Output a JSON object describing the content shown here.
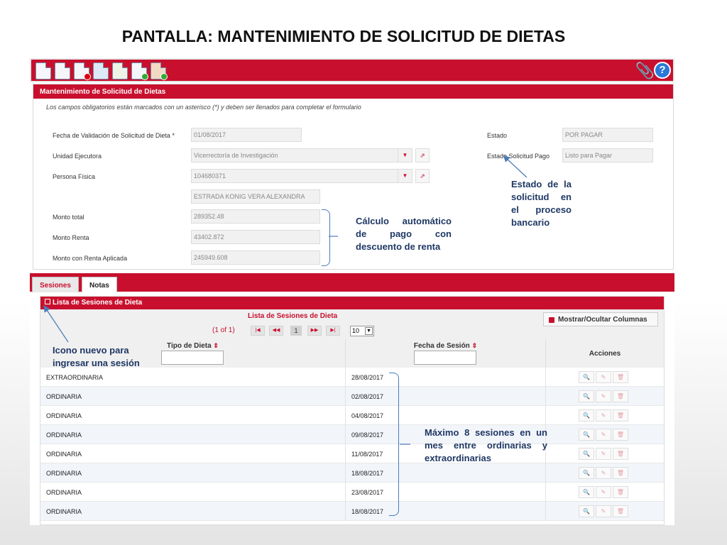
{
  "slide": {
    "title": "PANTALLA: MANTENIMIENTO DE SOLICITUD DE DIETAS"
  },
  "toolbar": {
    "icons": [
      "new-document-icon",
      "document-icon",
      "delete-document-icon",
      "workflow-icon",
      "report-icon",
      "export-document-icon",
      "add-user-icon"
    ],
    "attach_icon": "📎",
    "help_icon": "?"
  },
  "panel": {
    "title": "Mantenimiento de Solicitud de Dietas",
    "required_note": "Los campos obligatorios están marcados con un asterisco (*) y deben ser llenados para completar el formulario",
    "fields": {
      "fecha_label": "Fecha de Validación de Solicitud de Dieta *",
      "fecha_value": "01/08/2017",
      "unidad_label": "Unidad Ejecutora",
      "unidad_value": "Vicerrectoría de Investigación",
      "persona_label": "Persona Física",
      "persona_value": "104680371",
      "nombre_value": "ESTRADA KONIG VERA ALEXANDRA",
      "monto_total_label": "Monto total",
      "monto_total_value": "289352.48",
      "monto_renta_label": "Monto Renta",
      "monto_renta_value": "43402.872",
      "monto_aplicada_label": "Monto con Renta Aplicada",
      "monto_aplicada_value": "245949.608",
      "estado_label": "Estado",
      "estado_value": "POR PAGAR",
      "estado_pago_label": "Estado Solicitud Pago",
      "estado_pago_value": "Listo para Pagar"
    },
    "dropdown_glyph": "▼",
    "external_glyph": "⇗"
  },
  "annotations": {
    "estado": "Estado de la solicitud en el proceso bancario",
    "calculo": "Cálculo automático de pago con descuento de renta",
    "icono": "Icono nuevo para ingresar una sesión",
    "maximo": "Máximo 8 sesiones en un mes entre ordinarias y extraordinarias"
  },
  "tabs": [
    {
      "label": "Sesiones"
    },
    {
      "label": "Notas"
    }
  ],
  "grid": {
    "panel_title": "Lista de Sesiones de Dieta",
    "caption": "Lista de Sesiones de Dieta",
    "pager_count": "(1 of 1)",
    "pager_first": "|◀",
    "pager_prev": "◀◀",
    "current_page": "1",
    "pager_next": "▶▶",
    "pager_last": "▶|",
    "page_size": "10",
    "page_size_arrow": "▼",
    "columns_button": "Mostrar/Ocultar Columnas",
    "col_tipo": "Tipo de Dieta",
    "col_fecha": "Fecha de Sesión",
    "col_acciones": "Acciones",
    "sort_glyph": "⇕",
    "rows": [
      {
        "tipo": "EXTRAORDINARIA",
        "fecha": "28/08/2017"
      },
      {
        "tipo": "ORDINARIA",
        "fecha": "02/08/2017"
      },
      {
        "tipo": "ORDINARIA",
        "fecha": "04/08/2017"
      },
      {
        "tipo": "ORDINARIA",
        "fecha": "09/08/2017"
      },
      {
        "tipo": "ORDINARIA",
        "fecha": "11/08/2017"
      },
      {
        "tipo": "ORDINARIA",
        "fecha": "18/08/2017"
      },
      {
        "tipo": "ORDINARIA",
        "fecha": "23/08/2017"
      },
      {
        "tipo": "ORDINARIA",
        "fecha": "18/08/2017"
      }
    ],
    "action_glyphs": {
      "view": "🔍",
      "edit": "✎",
      "delete": "🗑"
    }
  }
}
